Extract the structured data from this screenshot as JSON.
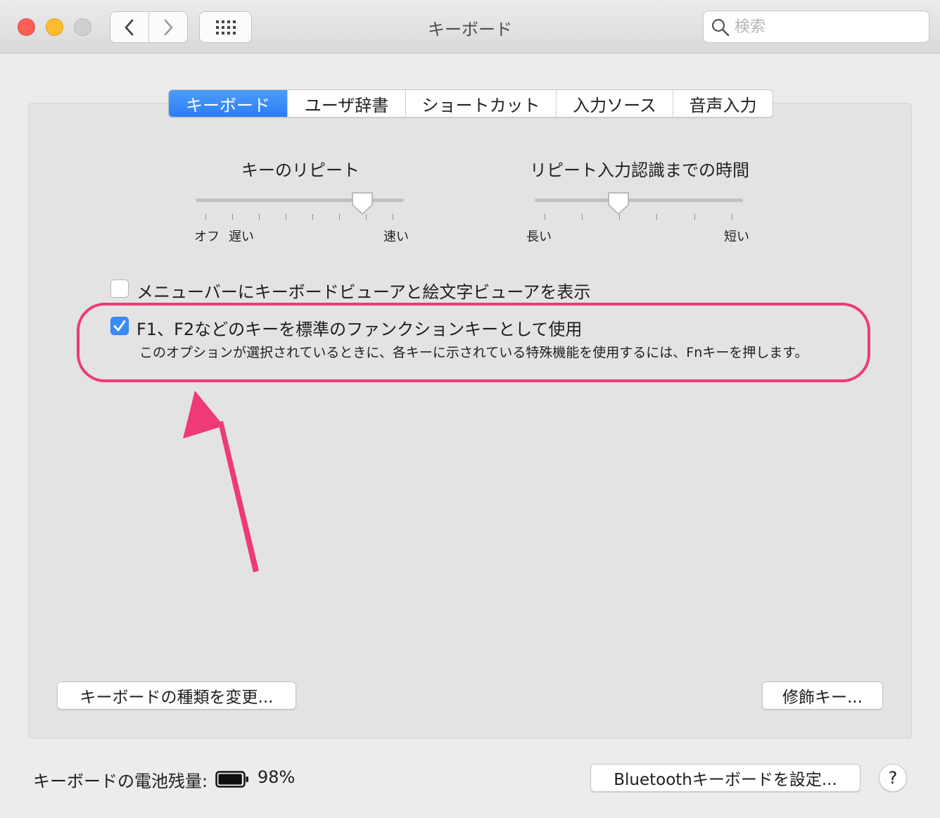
{
  "window": {
    "title": "キーボード"
  },
  "toolbar": {
    "back_icon": "chevron-left-icon",
    "forward_icon": "chevron-right-icon",
    "grid_icon": "grid-icon"
  },
  "search": {
    "placeholder": "検索",
    "value": ""
  },
  "tabs": [
    {
      "label": "キーボード",
      "active": true
    },
    {
      "label": "ユーザ辞書",
      "active": false
    },
    {
      "label": "ショートカット",
      "active": false
    },
    {
      "label": "入力ソース",
      "active": false
    },
    {
      "label": "音声入力",
      "active": false
    }
  ],
  "key_repeat": {
    "title": "キーのリピート",
    "label_off": "オフ",
    "label_slow": "遅い",
    "label_fast": "速い",
    "value_fraction": 0.82
  },
  "repeat_delay": {
    "title": "リピート入力認識までの時間",
    "label_long": "長い",
    "label_short": "短い",
    "value_fraction": 0.4
  },
  "options": {
    "show_viewers": {
      "label": "メニューバーにキーボードビューアと絵文字ビューアを表示",
      "checked": false
    },
    "use_fn_keys": {
      "label": "F1、F2などのキーを標準のファンクションキーとして使用",
      "description": "このオプションが選択されているときに、各キーに示されている特殊機能を使用するには、Fnキーを押します。",
      "checked": true
    }
  },
  "buttons": {
    "change_keyboard_type": "キーボードの種類を変更...",
    "modifier_keys": "修飾キー...",
    "setup_bluetooth": "Bluetoothキーボードを設定...",
    "help": "?"
  },
  "battery": {
    "label": "キーボードの電池残量:",
    "percent": "98%",
    "level": 0.98
  },
  "colors": {
    "accent": "#2a7ef4",
    "highlight": "#ee3a76"
  }
}
